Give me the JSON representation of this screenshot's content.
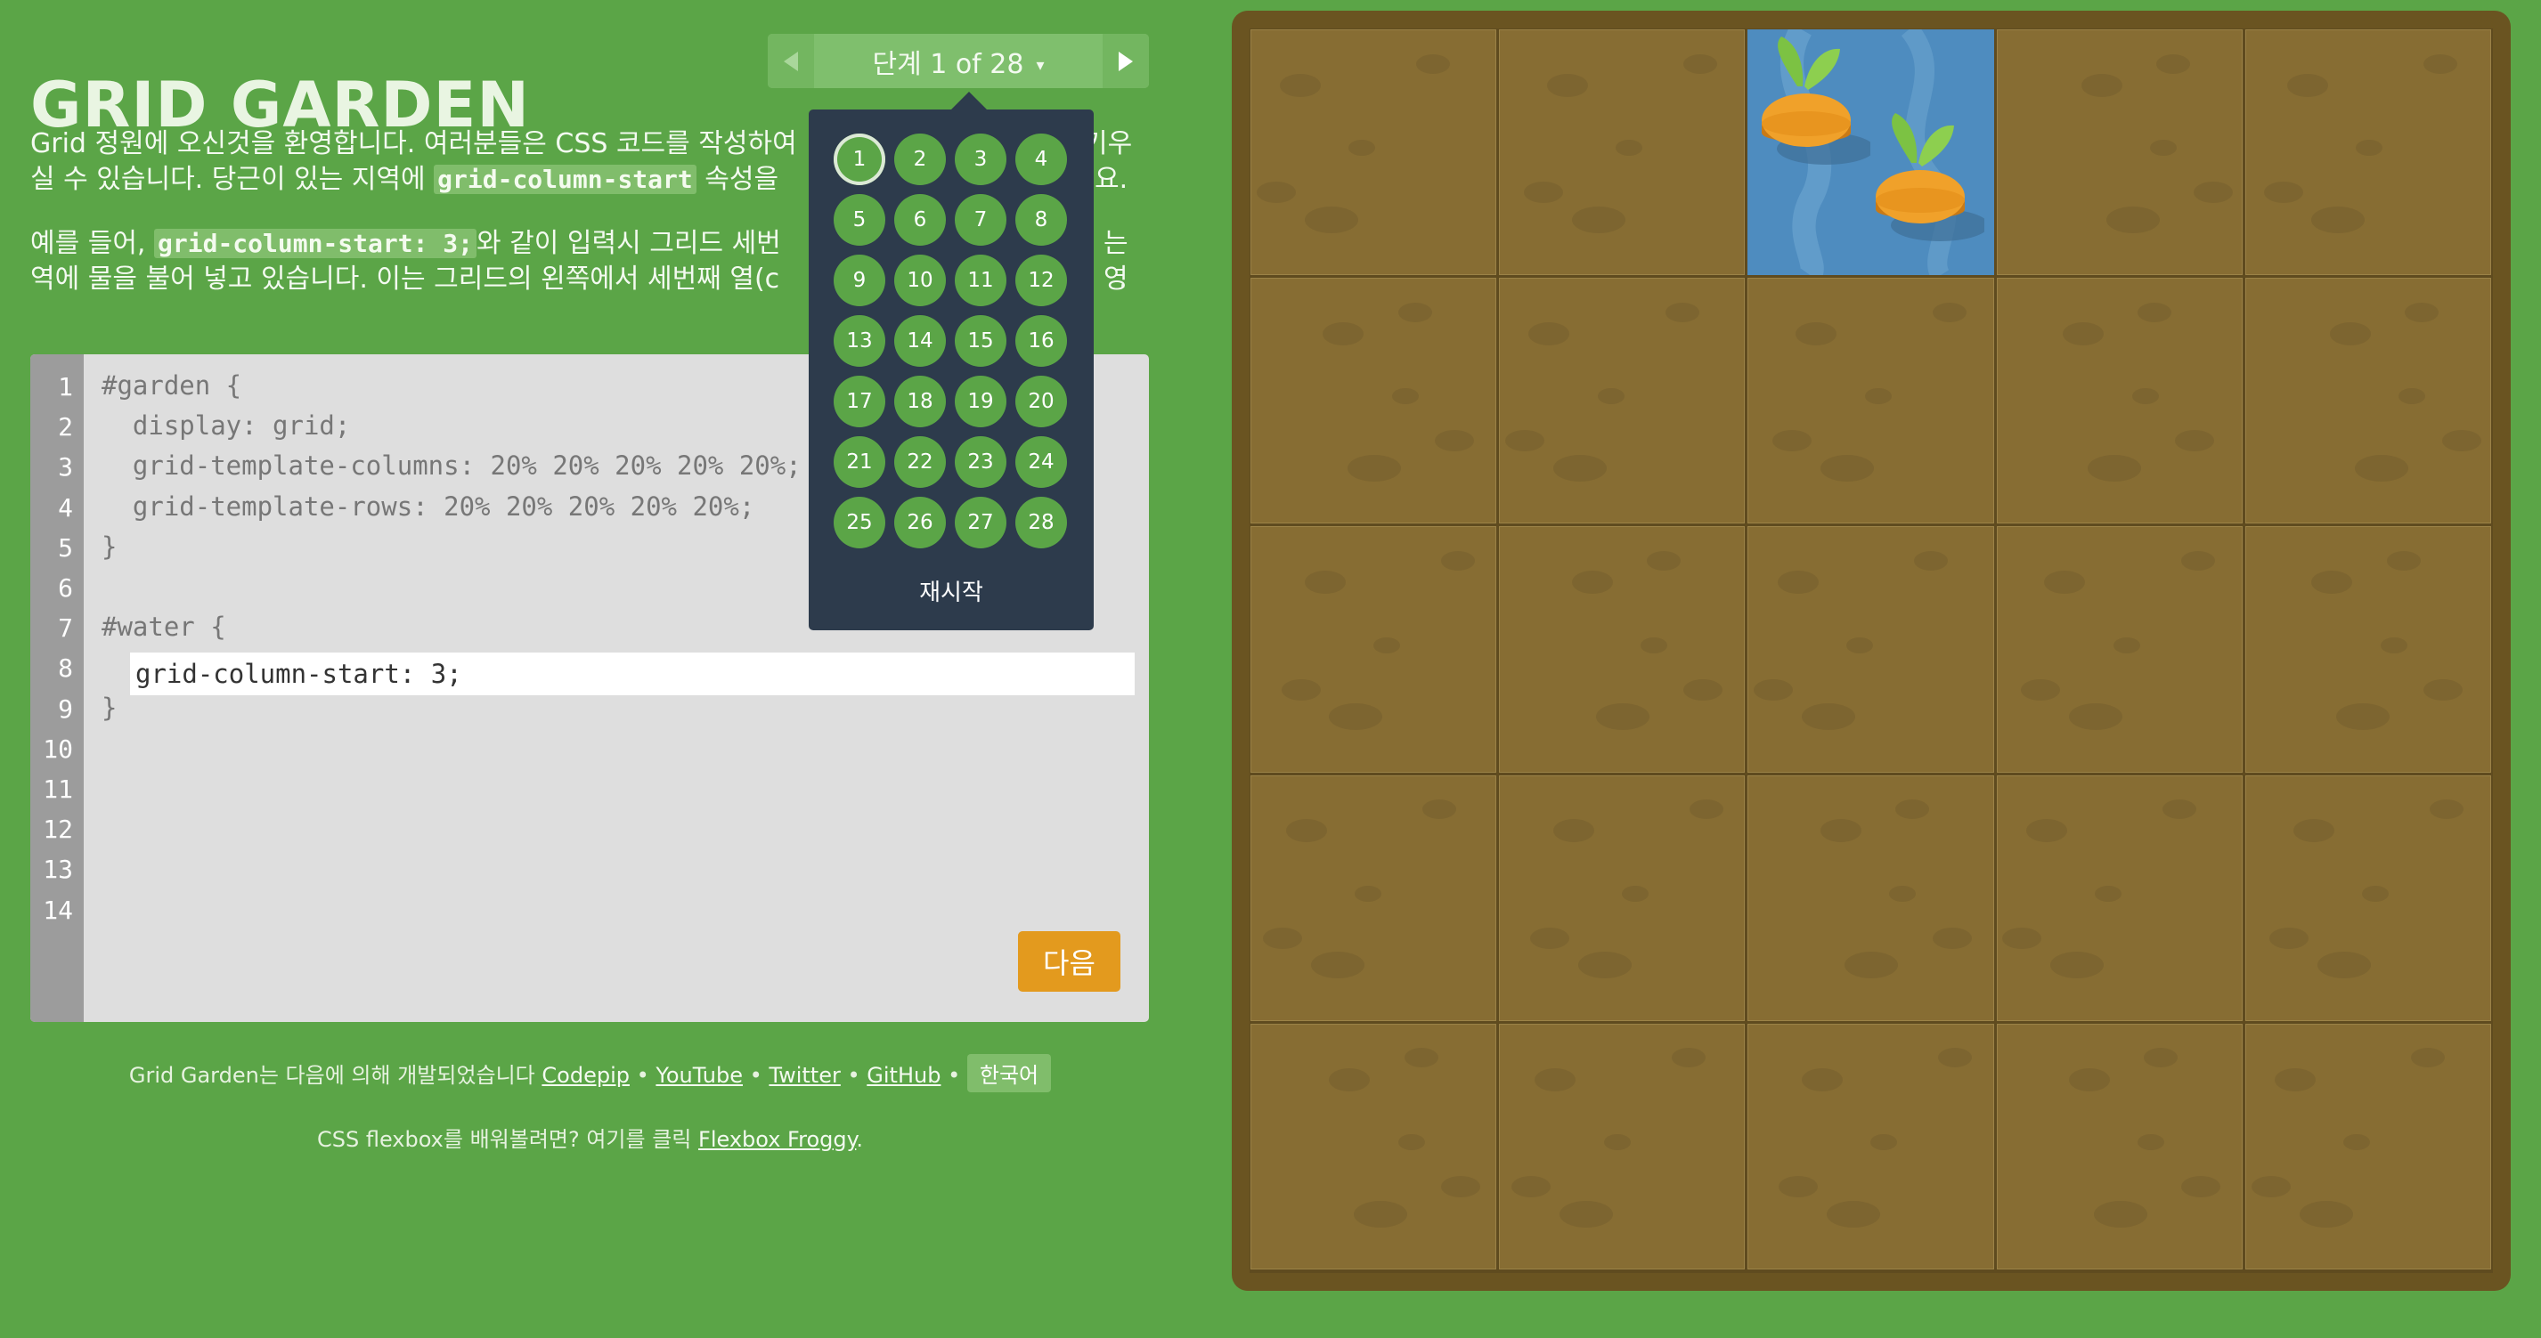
{
  "app": {
    "title": "GRID GARDEN"
  },
  "level_nav": {
    "label": "단계 1 of 28",
    "caret": "▾",
    "prev_icon": "triangle-left-icon",
    "next_icon": "triangle-right-icon"
  },
  "instructions": {
    "p1_before": "Grid 정원에 오신것을 환영합니다. 여러분들은 CSS 코드를 작성하여",
    "p1_hidden_tail": "키우",
    "p1_line2_before": "실 수 있습니다. 당근이 있는 지역에 ",
    "p1_code": "grid-column-start",
    "p1_line2_after": " 속성을",
    "p1_line2_end": "요.",
    "p2_before": "예를 들어, ",
    "p2_code": "grid-column-start: 3;",
    "p2_mid": "와 같이 입력시 그리드 세번",
    "p2_hidden_tail": "는 영",
    "p2_line2": "역에 물을 불어 넣고 있습니다. 이는 그리드의 왼쪽에서 세번째 열(c",
    "p2_line2_end": "."
  },
  "editor": {
    "line_numbers": [
      "1",
      "2",
      "3",
      "4",
      "5",
      "6",
      "7",
      "8",
      "9",
      "10",
      "11",
      "12",
      "13",
      "14"
    ],
    "code_lines": [
      "#garden {",
      "  display: grid;",
      "  grid-template-columns: 20% 20% 20% 20% 20%;",
      "  grid-template-rows: 20% 20% 20% 20% 20%;",
      "}",
      "",
      "#water {",
      "",
      "}"
    ],
    "answer_value": "grid-column-start: 3;",
    "next_label": "다음"
  },
  "level_dropdown": {
    "levels": [
      "1",
      "2",
      "3",
      "4",
      "5",
      "6",
      "7",
      "8",
      "9",
      "10",
      "11",
      "12",
      "13",
      "14",
      "15",
      "16",
      "17",
      "18",
      "19",
      "20",
      "21",
      "22",
      "23",
      "24",
      "25",
      "26",
      "27",
      "28"
    ],
    "current": "1",
    "reset_label": "재시작"
  },
  "footer": {
    "credits_prefix": "Grid Garden는 다음에 의해 개발되었습니다 ",
    "codepip": "Codepip",
    "youtube": "YouTube",
    "twitter": "Twitter",
    "github": "GitHub",
    "separator": " • ",
    "language": "한국어",
    "flexbox_prefix": "CSS flexbox를 배워볼려면? 여기를 클릭 ",
    "flexbox_link": "Flexbox Froggy",
    "flexbox_suffix": "."
  },
  "garden": {
    "rows": 5,
    "columns": 5,
    "water_column": 3,
    "water_row": 1,
    "carrot_count": 2
  },
  "colors": {
    "background": "#5ba547",
    "soil": "#876d33",
    "water": "#4e8cbf",
    "carrot": "#f0a12a",
    "leaf": "#7cc243",
    "dropdown": "#2d3b4c",
    "next_button": "#e39a1e"
  }
}
